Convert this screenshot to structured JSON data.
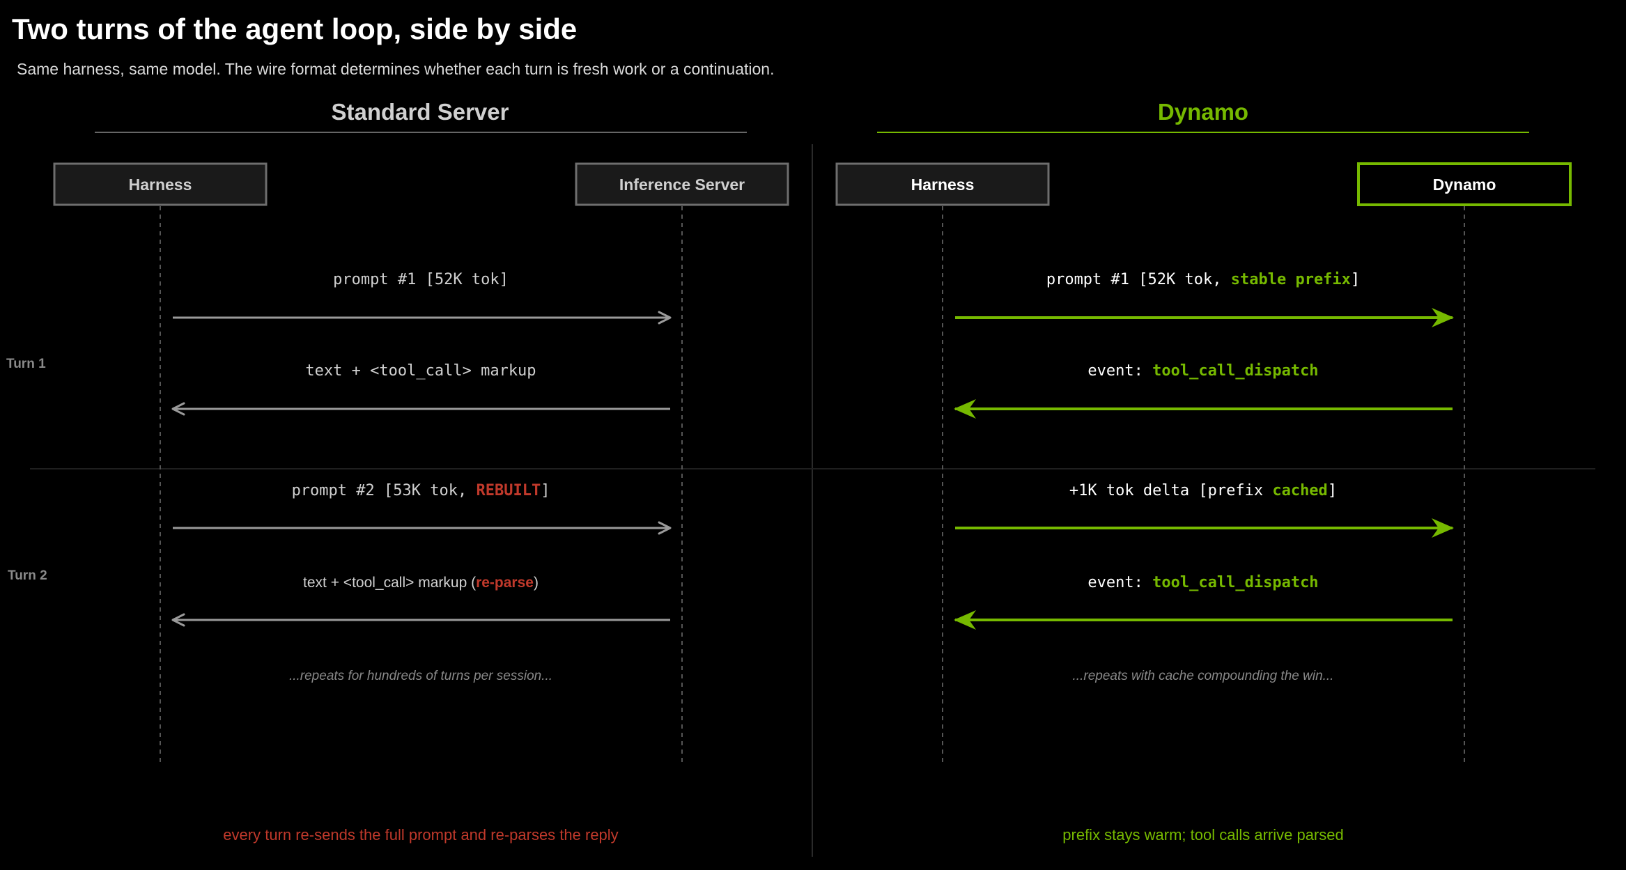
{
  "title": "Two turns of the agent loop, side by side",
  "subtitle": "Same harness, same model. The wire format determines whether each turn is fresh work or a continuation.",
  "colors": {
    "background": "#000000",
    "accent_green": "#76b900",
    "neutral_gray": "#9a9a9a",
    "warning_red": "#c0392b",
    "box_fill": "#1a1a1a",
    "box_border_gray": "#6e6e6e",
    "muted_text": "#888888"
  },
  "turn_labels": [
    "Turn 1",
    "Turn 2"
  ],
  "panels": {
    "standard": {
      "heading": "Standard Server",
      "participants": [
        "Harness",
        "Inference Server"
      ],
      "messages": [
        {
          "direction": "right",
          "style": "mono",
          "parts": [
            {
              "text": "prompt #1 [52K tok]",
              "tone": "normal"
            }
          ]
        },
        {
          "direction": "left",
          "style": "mono",
          "parts": [
            {
              "text": "text + <tool_call> markup",
              "tone": "normal"
            }
          ]
        },
        {
          "direction": "right",
          "style": "mono",
          "parts": [
            {
              "text": "prompt #2 [53K tok, ",
              "tone": "normal"
            },
            {
              "text": "REBUILT",
              "tone": "red"
            },
            {
              "text": "]",
              "tone": "normal"
            }
          ]
        },
        {
          "direction": "left",
          "style": "sans",
          "parts": [
            {
              "text": "text + <tool_call> markup (",
              "tone": "normal"
            },
            {
              "text": "re-parse",
              "tone": "red"
            },
            {
              "text": ")",
              "tone": "normal"
            }
          ]
        }
      ],
      "note": "...repeats for hundreds of turns per session...",
      "footer": "every turn re-sends the full prompt and re-parses the reply"
    },
    "dynamo": {
      "heading": "Dynamo",
      "participants": [
        "Harness",
        "Dynamo"
      ],
      "messages": [
        {
          "direction": "right",
          "style": "mono",
          "parts": [
            {
              "text": "prompt #1 [52K tok, ",
              "tone": "normal"
            },
            {
              "text": "stable prefix",
              "tone": "green"
            },
            {
              "text": "]",
              "tone": "normal"
            }
          ]
        },
        {
          "direction": "left",
          "style": "mono",
          "parts": [
            {
              "text": "event: ",
              "tone": "normal"
            },
            {
              "text": "tool_call_dispatch",
              "tone": "green"
            }
          ]
        },
        {
          "direction": "right",
          "style": "mono",
          "parts": [
            {
              "text": "+1K tok delta [prefix ",
              "tone": "normal"
            },
            {
              "text": "cached",
              "tone": "green"
            },
            {
              "text": "]",
              "tone": "normal"
            }
          ]
        },
        {
          "direction": "left",
          "style": "mono",
          "parts": [
            {
              "text": "event: ",
              "tone": "normal"
            },
            {
              "text": "tool_call_dispatch",
              "tone": "green"
            }
          ]
        }
      ],
      "note": "...repeats with cache compounding the win...",
      "footer": "prefix stays warm; tool calls arrive parsed"
    }
  }
}
